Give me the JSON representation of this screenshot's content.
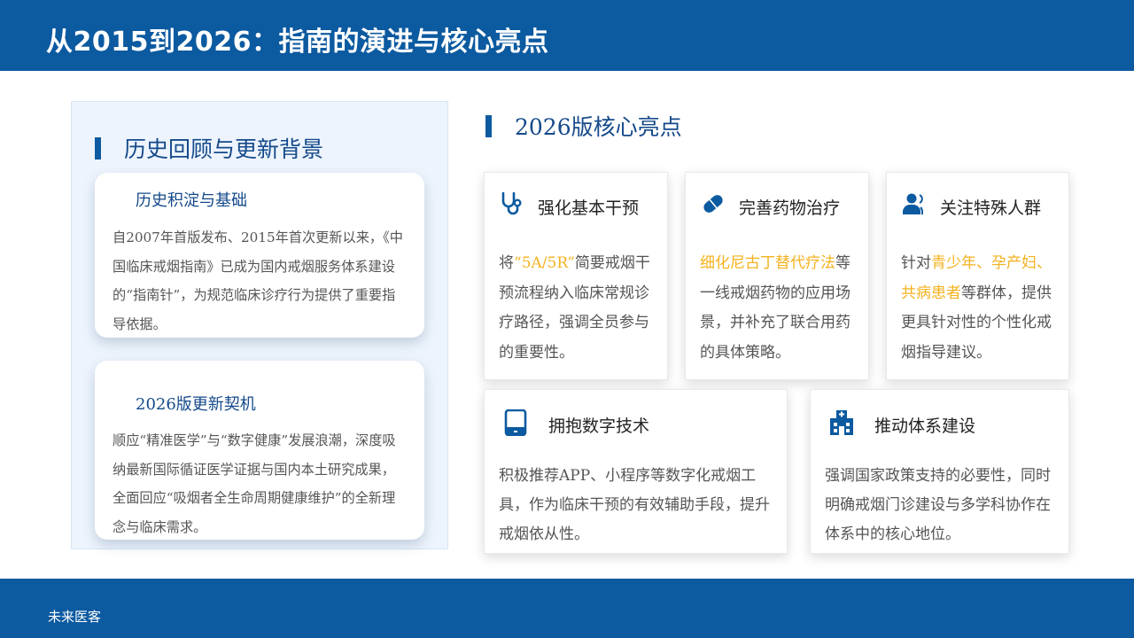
{
  "header": {
    "title": "从2015到2026：指南的演进与核心亮点"
  },
  "footer": {
    "brand": "未来医客"
  },
  "left": {
    "section_title": "历史回顾与更新背景",
    "cards": [
      {
        "title": "历史积淀与基础",
        "text": "自2007年首版发布、2015年首次更新以来，《中国临床戒烟指南》已成为国内戒烟服务体系建设的“指南针”，为规范临床诊疗行为提供了重要指导依据。"
      },
      {
        "title": "2026版更新契机",
        "text": "顺应“精准医学”与“数字健康”发展浪潮，深度吸纳最新国际循证医学证据与国内本土研究成果，全面回应“吸烟者全生命周期健康维护”的全新理念与临床需求。"
      }
    ]
  },
  "right": {
    "section_title": "2026版核心亮点",
    "cards": [
      {
        "icon": "stethoscope-icon",
        "title": "强化基本干预",
        "pre": "将",
        "highlight": "“5A/5R”",
        "post": "简要戒烟干预流程纳入临床常规诊疗路径，强调全员参与的重要性。"
      },
      {
        "icon": "pill-icon",
        "title": "完善药物治疗",
        "pre": "",
        "highlight": "细化尼古丁替代疗法",
        "post": "等一线戒烟药物的应用场景，并补充了联合用药的具体策略。"
      },
      {
        "icon": "user-group-icon",
        "title": "关注特殊人群",
        "pre": "针对",
        "highlight": "青少年、孕产妇、共病患者",
        "post": "等群体，提供更具针对性的个性化戒烟指导建议。"
      },
      {
        "icon": "tablet-icon",
        "title": "拥抱数字技术",
        "text": "积极推荐APP、小程序等数字化戒烟工具，作为临床干预的有效辅助手段，提升戒烟依从性。"
      },
      {
        "icon": "hospital-icon",
        "title": "推动体系建设",
        "text": "强调国家政策支持的必要性，同时明确戒烟门诊建设与多学科协作在体系中的核心地位。"
      }
    ]
  },
  "colors": {
    "primary": "#0c5aa0",
    "title_blue": "#14498a",
    "highlight": "#f4b21f"
  }
}
